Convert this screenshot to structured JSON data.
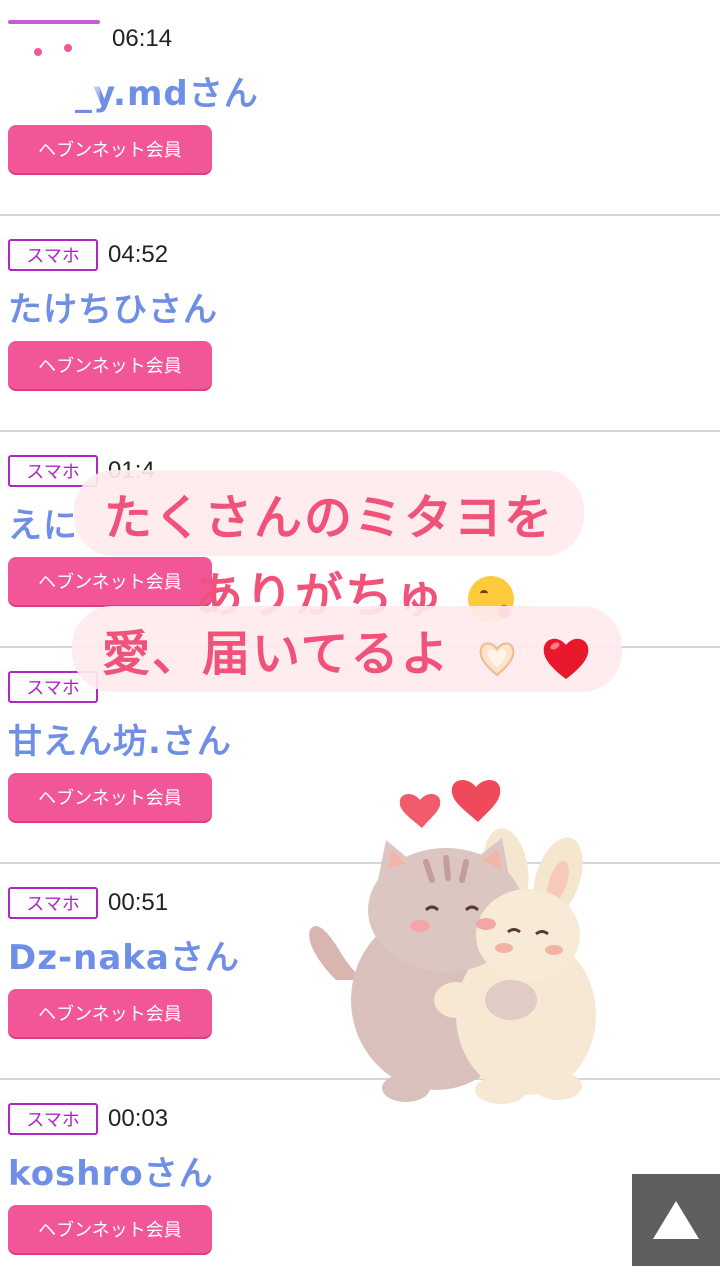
{
  "entries": [
    {
      "device": "",
      "time": "06:14",
      "name": "_y.mdさん",
      "member": "ヘブンネット会員"
    },
    {
      "device": "スマホ",
      "time": "04:52",
      "name": "たけちひさん",
      "member": "ヘブンネット会員"
    },
    {
      "device": "スマホ",
      "time": "01:4",
      "name": "えに",
      "member": "ヘブンネット会員"
    },
    {
      "device": "スマホ",
      "time": "",
      "name": "甘えん坊.さん",
      "member": "ヘブンネット会員"
    },
    {
      "device": "スマホ",
      "time": "00:51",
      "name": "Dz-nakaさん",
      "member": "ヘブンネット会員"
    },
    {
      "device": "スマホ",
      "time": "00:03",
      "name": "koshroさん",
      "member": "ヘブンネット会員"
    }
  ],
  "overlay": {
    "line1": "たくさんのミタヨを",
    "line2": "ありがちゅ",
    "line3": "愛、届いてるよ",
    "icons": [
      "kissing-face-icon",
      "heart-hands-icon",
      "red-heart-icon"
    ]
  },
  "colors": {
    "badge": "#b026c7",
    "name": "#6f8fe6",
    "member_button": "#f25699",
    "caption": "#f0527a",
    "to_top": "#5f5f5f"
  },
  "to_top": {
    "icon": "up-triangle-icon"
  }
}
